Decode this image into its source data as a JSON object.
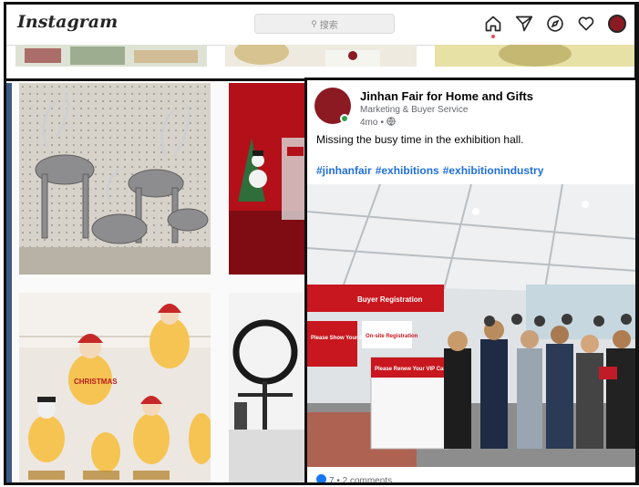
{
  "nav": {
    "logo": "Instagram",
    "search_placeholder": "搜索",
    "icons": [
      "home-icon",
      "direct-icon",
      "explore-icon",
      "heart-icon",
      "avatar"
    ]
  },
  "post": {
    "author": "Jinhan Fair for Home and Gifts",
    "subtitle": "Marketing & Buyer Service",
    "time": "4mo",
    "text": "Missing the busy time in the exhibition hall.",
    "hashtags": [
      "#jinhanfair",
      "#exhibitions",
      "#exhibitionindustry"
    ],
    "photo_banner": "Buyer Registration",
    "sign_vip": "Please Renew Your VIP Card",
    "sign_badge": "Please Show Your Badge",
    "sign_onsite": "On-site Registration",
    "reactions": "7 • 2 comments"
  },
  "grid": {
    "tile_names": [
      "reindeer-decor",
      "snowman-display",
      "led-christmas-figures",
      "ring-light-products"
    ],
    "santa_label": "CHRISTMAS"
  },
  "colors": {
    "brand": "#8b1a23",
    "hashtag": "#216fdb",
    "border": "#111111"
  }
}
